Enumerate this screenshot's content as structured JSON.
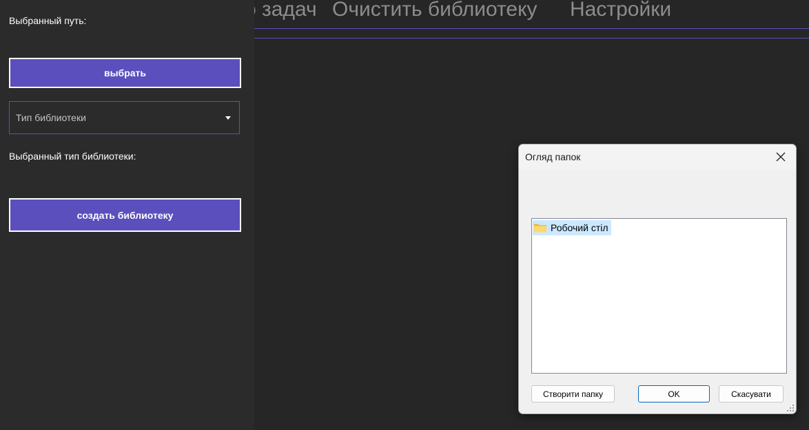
{
  "left_panel": {
    "selected_path_label": "Выбранный путь:",
    "select_button_label": "выбрать",
    "library_type_placeholder": "Тип библиотеки",
    "selected_type_label": "Выбранный тип библиотеки:",
    "create_button_label": "создать библиотеку"
  },
  "top_menu": {
    "items": [
      "о задач",
      "Очистить библиотеку",
      "Настройки"
    ]
  },
  "dialog": {
    "title": "Огляд папок",
    "tree_items": [
      "Робочий стіл"
    ],
    "buttons": {
      "new_folder": "Створити папку",
      "ok": "OK",
      "cancel": "Скасувати"
    }
  },
  "colors": {
    "accent": "#5b4fbd",
    "background": "#262626",
    "panel": "#2b2b2b",
    "dialog_bg": "#f0f0f0",
    "selection": "#cce8ff"
  }
}
